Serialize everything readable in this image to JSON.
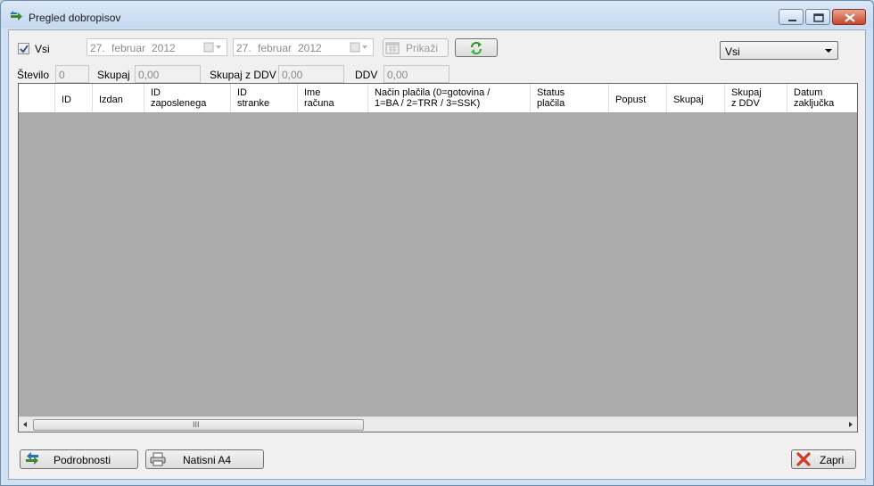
{
  "window": {
    "title": "Pregled dobropisov"
  },
  "filter": {
    "all_checkbox": {
      "label": "Vsi",
      "checked": true
    },
    "date_from": {
      "day": "27.",
      "month": "februar",
      "year": "2012"
    },
    "date_to": {
      "day": "27.",
      "month": "februar",
      "year": "2012"
    },
    "show_button": "Prikaži",
    "refresh_icon": "refresh-icon",
    "dropdown": {
      "selected": "Vsi"
    }
  },
  "summary": {
    "count_label": "Število",
    "count_value": "0",
    "total_label": "Skupaj",
    "total_value": "0,00",
    "total_vat_label": "Skupaj z DDV",
    "total_vat_value": "0,00",
    "vat_label": "DDV",
    "vat_value": "0,00"
  },
  "grid": {
    "columns": [
      "ID",
      "Izdan",
      "ID\nzaposlenega",
      "ID\nstranke",
      "Ime\nračuna",
      "Način plačila (0=gotovina /\n1=BA / 2=TRR / 3=SSK)",
      "Status\nplačila",
      "Popust",
      "Skupaj",
      "Skupaj\nz DDV",
      "Datum\nzaključka"
    ],
    "rows": [],
    "scroll_grip": "III"
  },
  "footer": {
    "details_button": "Podrobnosti",
    "print_button": "Natisni A4",
    "close_button": "Zapri"
  },
  "colors": {
    "grid_background": "#ababab",
    "window_frame": "#cfe0f3",
    "close_red": "#c7452b"
  }
}
